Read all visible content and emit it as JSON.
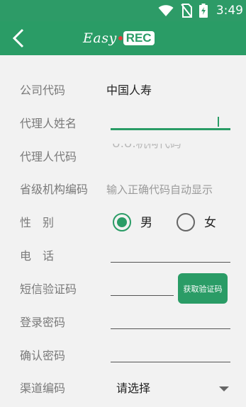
{
  "status_bar": {
    "time": "3:49",
    "icons": [
      "wifi-icon",
      "no-sim-icon",
      "battery-charging-icon"
    ]
  },
  "app_bar": {
    "back_icon": "chevron-left-icon",
    "logo_easy": "Easy",
    "logo_rec": "REC"
  },
  "form": {
    "company_code": {
      "label": "公司代码",
      "value": "中国人寿"
    },
    "agent_name": {
      "label": "代理人姓名",
      "value": ""
    },
    "agent_code": {
      "label": "代理人代码",
      "placeholder": "U.U.机构代码"
    },
    "province_code": {
      "label": "省级机构编码",
      "hint": "输入正确代码自动显示"
    },
    "gender": {
      "label": "性　别",
      "option_male": "男",
      "option_female": "女",
      "selected": "男"
    },
    "phone": {
      "label": "电　话",
      "value": ""
    },
    "sms_code": {
      "label": "短信验证码",
      "button": "获取验证码"
    },
    "login_password": {
      "label": "登录密码",
      "value": ""
    },
    "confirm_password": {
      "label": "确认密码",
      "value": ""
    },
    "channel_code": {
      "label": "渠道编码",
      "selected": "请选择"
    }
  },
  "colors": {
    "brand_green": "#2a9c66",
    "status_green": "#2d9b67"
  }
}
